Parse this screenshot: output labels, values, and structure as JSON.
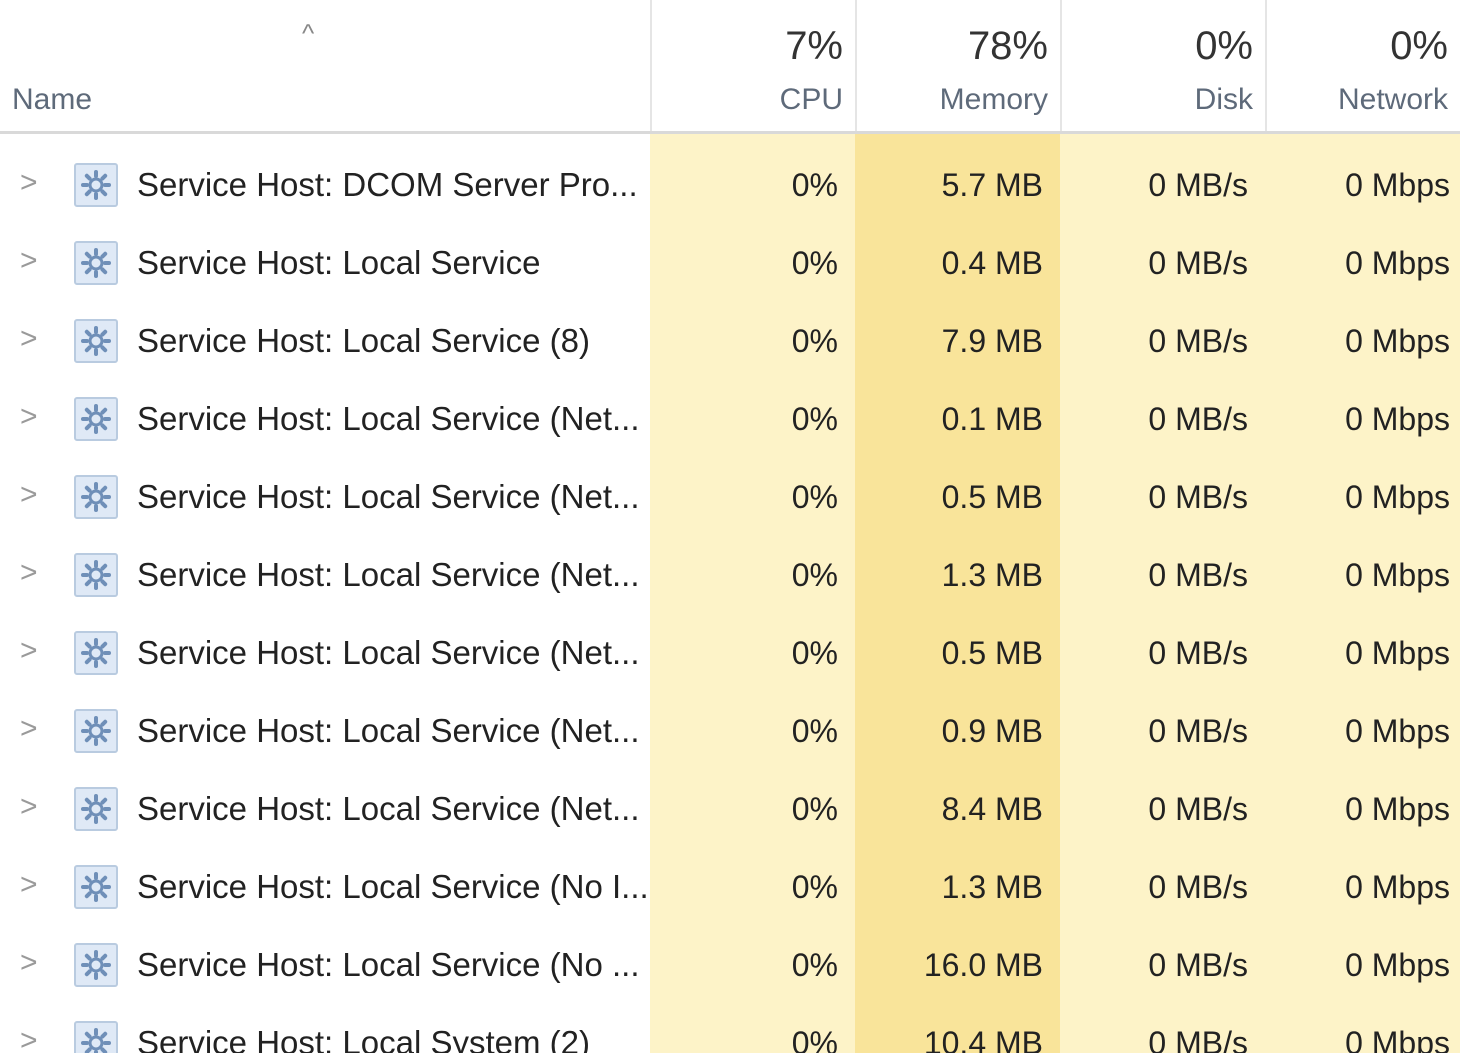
{
  "header": {
    "sort_indicator": "^",
    "name_label": "Name",
    "cpu_percent": "7%",
    "cpu_label": "CPU",
    "memory_percent": "78%",
    "memory_label": "Memory",
    "disk_percent": "0%",
    "disk_label": "Disk",
    "network_percent": "0%",
    "network_label": "Network"
  },
  "colors": {
    "cpu_bg": "#fdf3c8",
    "memory_bg": "#f9e49a",
    "disk_bg": "#fdf3c8",
    "network_bg": "#fdf3c8"
  },
  "icons": {
    "expand": "chevron-right-icon",
    "process": "gear-icon"
  },
  "rows": [
    {
      "expand": ">",
      "name": "Service Host: DCOM Server Pro...",
      "cpu": "0%",
      "memory": "5.7 MB",
      "disk": "0 MB/s",
      "network": "0 Mbps"
    },
    {
      "expand": ">",
      "name": "Service Host: Local Service",
      "cpu": "0%",
      "memory": "0.4 MB",
      "disk": "0 MB/s",
      "network": "0 Mbps"
    },
    {
      "expand": ">",
      "name": "Service Host: Local Service (8)",
      "cpu": "0%",
      "memory": "7.9 MB",
      "disk": "0 MB/s",
      "network": "0 Mbps"
    },
    {
      "expand": ">",
      "name": "Service Host: Local Service (Net...",
      "cpu": "0%",
      "memory": "0.1 MB",
      "disk": "0 MB/s",
      "network": "0 Mbps"
    },
    {
      "expand": ">",
      "name": "Service Host: Local Service (Net...",
      "cpu": "0%",
      "memory": "0.5 MB",
      "disk": "0 MB/s",
      "network": "0 Mbps"
    },
    {
      "expand": ">",
      "name": "Service Host: Local Service (Net...",
      "cpu": "0%",
      "memory": "1.3 MB",
      "disk": "0 MB/s",
      "network": "0 Mbps"
    },
    {
      "expand": ">",
      "name": "Service Host: Local Service (Net...",
      "cpu": "0%",
      "memory": "0.5 MB",
      "disk": "0 MB/s",
      "network": "0 Mbps"
    },
    {
      "expand": ">",
      "name": "Service Host: Local Service (Net...",
      "cpu": "0%",
      "memory": "0.9 MB",
      "disk": "0 MB/s",
      "network": "0 Mbps"
    },
    {
      "expand": ">",
      "name": "Service Host: Local Service (Net...",
      "cpu": "0%",
      "memory": "8.4 MB",
      "disk": "0 MB/s",
      "network": "0 Mbps"
    },
    {
      "expand": ">",
      "name": "Service Host: Local Service (No I...",
      "cpu": "0%",
      "memory": "1.3 MB",
      "disk": "0 MB/s",
      "network": "0 Mbps"
    },
    {
      "expand": ">",
      "name": "Service Host: Local Service (No ...",
      "cpu": "0%",
      "memory": "16.0 MB",
      "disk": "0 MB/s",
      "network": "0 Mbps"
    },
    {
      "expand": ">",
      "name": "Service Host: Local System (2)",
      "cpu": "0%",
      "memory": "10.4 MB",
      "disk": "0 MB/s",
      "network": "0 Mbps"
    }
  ]
}
